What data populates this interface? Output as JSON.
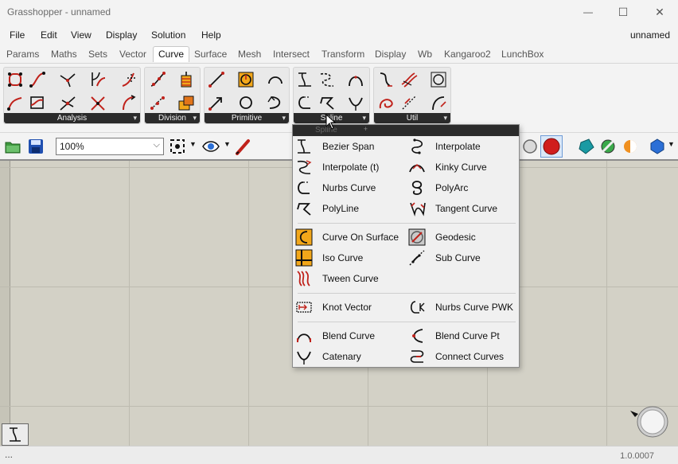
{
  "window": {
    "title": "Grasshopper - unnamed",
    "controls": {
      "minimize": "—",
      "maximize": "☐",
      "close": "✕"
    }
  },
  "menubar": {
    "items": [
      "File",
      "Edit",
      "View",
      "Display",
      "Solution",
      "Help"
    ],
    "document_name": "unnamed"
  },
  "tabs": {
    "items": [
      "Params",
      "Maths",
      "Sets",
      "Vector",
      "Curve",
      "Surface",
      "Mesh",
      "Intersect",
      "Transform",
      "Display",
      "Wb",
      "Kangaroo2",
      "LunchBox"
    ],
    "active": "Curve"
  },
  "ribbon": {
    "panels": [
      {
        "label": "Analysis"
      },
      {
        "label": "Division"
      },
      {
        "label": "Primitive"
      },
      {
        "label": "Spline"
      },
      {
        "label": "Util"
      }
    ]
  },
  "toolbar": {
    "zoom": "100%"
  },
  "dropdown": {
    "header_ghost": "Spline",
    "items_left": [
      {
        "label": "Bezier Span",
        "icon": "bezier-span-icon"
      },
      {
        "label": "Interpolate (t)",
        "icon": "interpolate-t-icon"
      },
      {
        "label": "Nurbs Curve",
        "icon": "nurbs-curve-icon"
      },
      {
        "label": "PolyLine",
        "icon": "polyline-icon"
      },
      {
        "label": "Curve On Surface",
        "icon": "curve-on-surface-icon"
      },
      {
        "label": "Iso Curve",
        "icon": "iso-curve-icon"
      },
      {
        "label": "Tween Curve",
        "icon": "tween-curve-icon"
      },
      {
        "label": "Knot Vector",
        "icon": "knot-vector-icon"
      },
      {
        "label": "Blend Curve",
        "icon": "blend-curve-icon"
      },
      {
        "label": "Catenary",
        "icon": "catenary-icon"
      }
    ],
    "items_right": [
      {
        "label": "Interpolate",
        "icon": "interpolate-icon"
      },
      {
        "label": "Kinky Curve",
        "icon": "kinky-curve-icon"
      },
      {
        "label": "PolyArc",
        "icon": "polyarc-icon"
      },
      {
        "label": "Tangent Curve",
        "icon": "tangent-curve-icon"
      },
      {
        "label": "Geodesic",
        "icon": "geodesic-icon"
      },
      {
        "label": "Sub Curve",
        "icon": "sub-curve-icon"
      },
      {
        "label": "Nurbs Curve PWK",
        "icon": "nurbs-curve-pwk-icon"
      },
      {
        "label": "Blend Curve Pt",
        "icon": "blend-curve-pt-icon"
      },
      {
        "label": "Connect Curves",
        "icon": "connect-curves-icon"
      }
    ]
  },
  "statusbar": {
    "left": "...",
    "version": "1.0.0007"
  },
  "colors": {
    "accent_red": "#c0221b",
    "canvas": "#d3d1c6",
    "panel_label_bg": "#2b2b2b"
  }
}
